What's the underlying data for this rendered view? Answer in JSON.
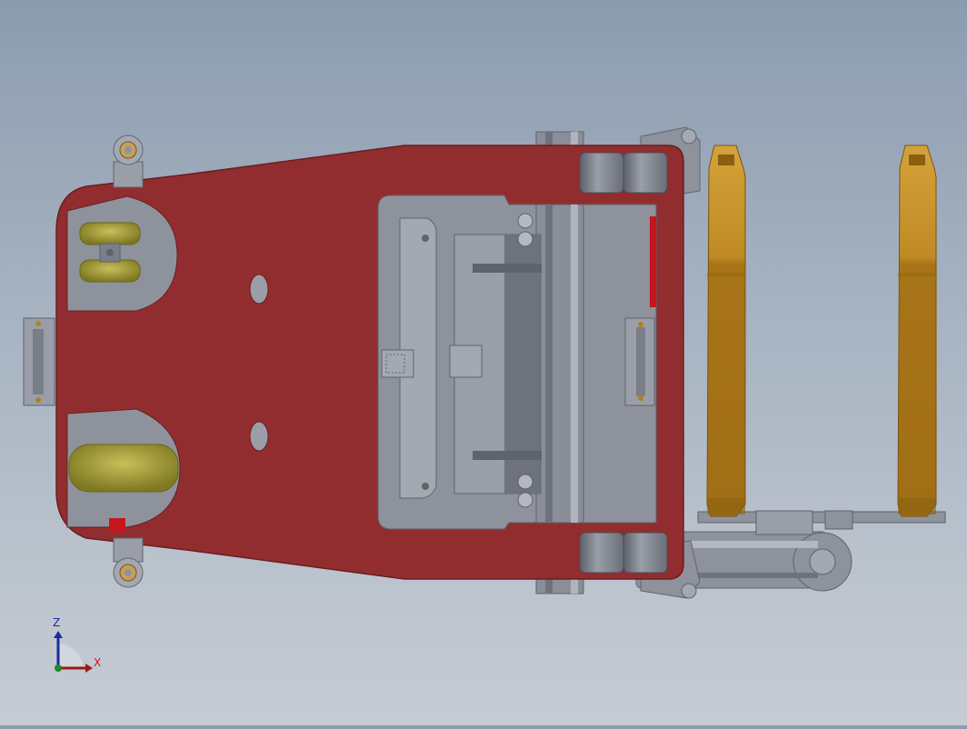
{
  "viewport": {
    "background_top": "#8c9caf",
    "background_bottom": "#c6ccd4"
  },
  "colors": {
    "frame": "#922d2f",
    "frame_edge": "#6a1e20",
    "steel": "#8e929c",
    "steel_dark": "#5f636c",
    "steel_light": "#b4b8c0",
    "fork": "#b47f1e",
    "fork_light": "#d49a2a",
    "wheel": "#a8a048",
    "roller": "#7a7e88",
    "accent_red": "#c8141c"
  },
  "triad": {
    "z_label": "Z",
    "x_label": "X",
    "z_icon": "arrow-up-icon",
    "x_icon": "arrow-right-icon"
  }
}
